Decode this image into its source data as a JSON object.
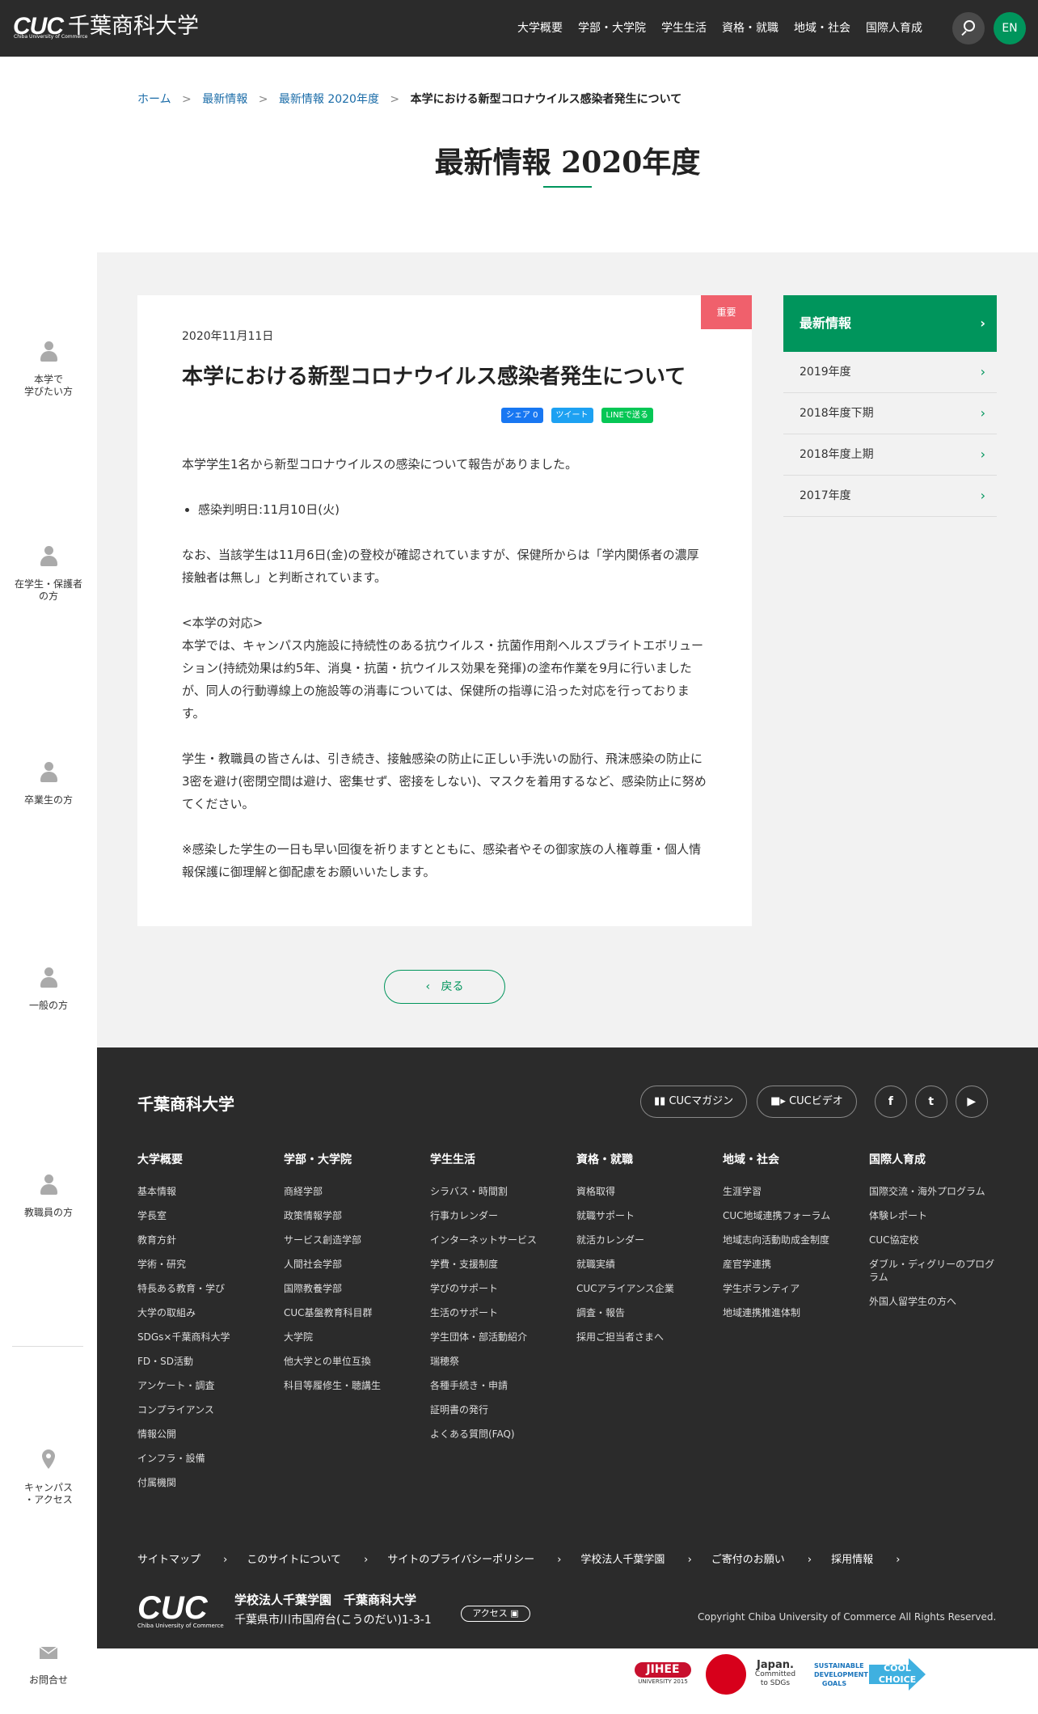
{
  "header": {
    "logo_mark": "CUC",
    "logo_sub": "Chiba University of Commerce",
    "logo_jp": "千葉商科大学",
    "nav": [
      "大学概要",
      "学部・大学院",
      "学生生活",
      "資格・就職",
      "地域・社会",
      "国際人育成"
    ],
    "lang_button": "EN"
  },
  "sidebar": {
    "items": [
      {
        "label": "本学で\n学びたい方"
      },
      {
        "label": "在学生・保護者\nの方"
      },
      {
        "label": "卒業生の方"
      },
      {
        "label": "一般の方"
      },
      {
        "label": "教職員の方"
      },
      {
        "label": "キャンパス\n・アクセス"
      },
      {
        "label": "お問合せ"
      }
    ]
  },
  "breadcrumb": [
    "ホーム",
    "最新情報",
    "最新情報 2020年度",
    "本学における新型コロナウイルス感染者発生について"
  ],
  "page_title": "最新情報 2020年度",
  "article": {
    "badge": "重要",
    "date": "2020年11月11日",
    "title": "本学における新型コロナウイルス感染者発生について",
    "share": {
      "facebook": "シェア 0",
      "twitter": "ツイート",
      "line": "LINEで送る"
    },
    "p1": "本学学生1名から新型コロナウイルスの感染について報告がありました。",
    "li1": "感染判明日:11月10日(火)",
    "p2": "なお、当該学生は11月6日(金)の登校が確認されていますが、保健所からは「学内関係者の濃厚接触者は無し」と判断されています。",
    "p3_head": "<本学の対応>",
    "p3": "本学では、キャンパス内施設に持続性のある抗ウイルス・抗菌作用剤ヘルスブライトエボリューション(持続効果は約5年、消臭・抗菌・抗ウイルス効果を発揮)の塗布作業を9月に行いましたが、同人の行動導線上の施設等の消毒については、保健所の指導に沿った対応を行っております。",
    "p4": "学生・教職員の皆さんは、引き続き、接触感染の防止に正しい手洗いの励行、飛沫感染の防止に3密を避け(密閉空間は避け、密集せず、密接をしない)、マスクを着用するなど、感染防止に努めてください。",
    "p5": "※感染した学生の一日も早い回復を祈りますとともに、感染者やその御家族の人権尊重・個人情報保護に御理解と御配慮をお願いいたします。"
  },
  "back_button": "戻る",
  "side_nav": {
    "header": "最新情報",
    "items": [
      "2019年度",
      "2018年度下期",
      "2018年度上期",
      "2017年度"
    ]
  },
  "footer": {
    "name": "千葉商科大学",
    "buttons": [
      "CUCマガジン",
      "CUCビデオ"
    ],
    "social": [
      "facebook-icon",
      "twitter-icon",
      "youtube-icon"
    ],
    "columns": [
      {
        "heading": "大学概要",
        "links": [
          "基本情報",
          "学長室",
          "教育方針",
          "学術・研究",
          "特長ある教育・学び",
          "大学の取組み",
          "SDGs×千葉商科大学",
          "FD・SD活動",
          "アンケート・調査",
          "コンプライアンス",
          "情報公開",
          "インフラ・設備",
          "付属機関"
        ]
      },
      {
        "heading": "学部・大学院",
        "links": [
          "商経学部",
          "政策情報学部",
          "サービス創造学部",
          "人間社会学部",
          "国際教養学部",
          "CUC基盤教育科目群",
          "大学院",
          "他大学との単位互換",
          "科目等履修生・聴講生"
        ]
      },
      {
        "heading": "学生生活",
        "links": [
          "シラバス・時間割",
          "行事カレンダー",
          "インターネットサービス",
          "学費・支援制度",
          "学びのサポート",
          "生活のサポート",
          "学生団体・部活動紹介",
          "瑞穂祭",
          "各種手続き・申請",
          "証明書の発行",
          "よくある質問(FAQ)"
        ]
      },
      {
        "heading": "資格・就職",
        "links": [
          "資格取得",
          "就職サポート",
          "就活カレンダー",
          "就職実績",
          "CUCアライアンス企業",
          "調査・報告",
          "採用ご担当者さまへ"
        ]
      },
      {
        "heading": "地域・社会",
        "links": [
          "生涯学習",
          "CUC地域連携フォーラム",
          "地域志向活動助成金制度",
          "産官学連携",
          "学生ボランティア",
          "地域連携推進体制"
        ]
      },
      {
        "heading": "国際人育成",
        "links": [
          "国際交流・海外プログラム",
          "体験レポート",
          "CUC協定校",
          "ダブル・ディグリーのプログラム",
          "外国人留学生の方へ"
        ]
      }
    ],
    "bottom_links": [
      "サイトマップ",
      "このサイトについて",
      "サイトのプライバシーポリシー",
      "学校法人千葉学園",
      "ご寄付のお願い",
      "採用情報"
    ],
    "logo_mark": "CUC",
    "logo_sub": "Chiba University of Commerce",
    "org": "学校法人千葉学園　千葉商科大学",
    "address": "千葉県市川市国府台(こうのだい)1-3-1",
    "access": "アクセス",
    "copyright": "Copyright Chiba University of Commerce All Rights Reserved."
  },
  "banners": {
    "jihee": "JIHEE",
    "jihee_sub": "UNIVERSITY 2015",
    "japan": "Japan.",
    "japan_sub": "Committed to SDGs",
    "sdgs": "SUSTAINABLE DEVELOPMENT GOALS",
    "cool": "COOL CHOICE"
  },
  "colors": {
    "accent": "#00955c",
    "badge": "#f0606c",
    "header_bg": "#2b2b2b",
    "link": "#1b6ca8"
  }
}
